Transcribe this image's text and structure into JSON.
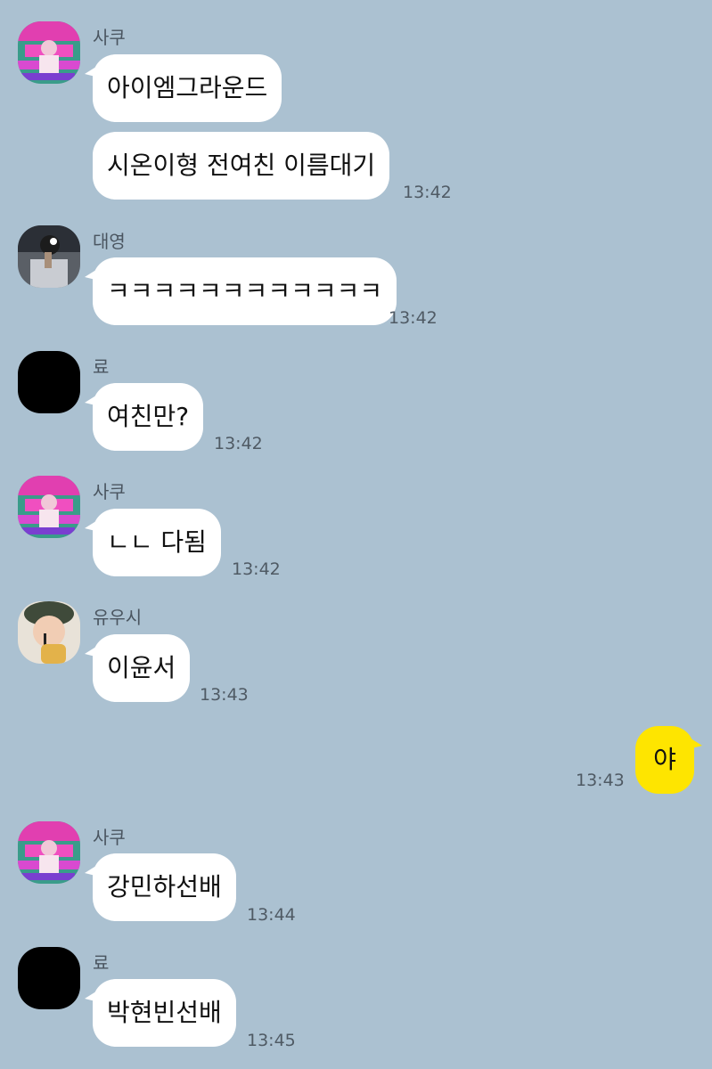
{
  "colors": {
    "background": "#abc1d1",
    "my_bubble": "#fee500",
    "other_bubble": "#ffffff"
  },
  "messages": [
    {
      "sender": "사쿠",
      "avatar": "saku-avatar-icon",
      "texts": [
        "아이엠그라운드",
        "시온이형 전여친 이름대기"
      ],
      "time": "13:42"
    },
    {
      "sender": "대영",
      "avatar": "daeyoung-avatar-icon",
      "texts": [
        "ㅋㅋㅋㅋㅋㅋㅋㅋㅋㅋㅋㅋ"
      ],
      "time": "13:42"
    },
    {
      "sender": "료",
      "avatar": "ryo-avatar-icon",
      "texts": [
        "여친만?"
      ],
      "time": "13:42"
    },
    {
      "sender": "사쿠",
      "avatar": "saku-avatar-icon",
      "texts": [
        "ㄴㄴ 다됨"
      ],
      "time": "13:42"
    },
    {
      "sender": "유우시",
      "avatar": "yuushi-avatar-icon",
      "texts": [
        "이윤서"
      ],
      "time": "13:43"
    },
    {
      "sender": "",
      "mine": true,
      "texts": [
        "야"
      ],
      "time": "13:43"
    },
    {
      "sender": "사쿠",
      "avatar": "saku-avatar-icon",
      "texts": [
        "강민하선배"
      ],
      "time": "13:44"
    },
    {
      "sender": "료",
      "avatar": "ryo-avatar-icon",
      "texts": [
        "박현빈선배"
      ],
      "time": "13:45"
    }
  ]
}
